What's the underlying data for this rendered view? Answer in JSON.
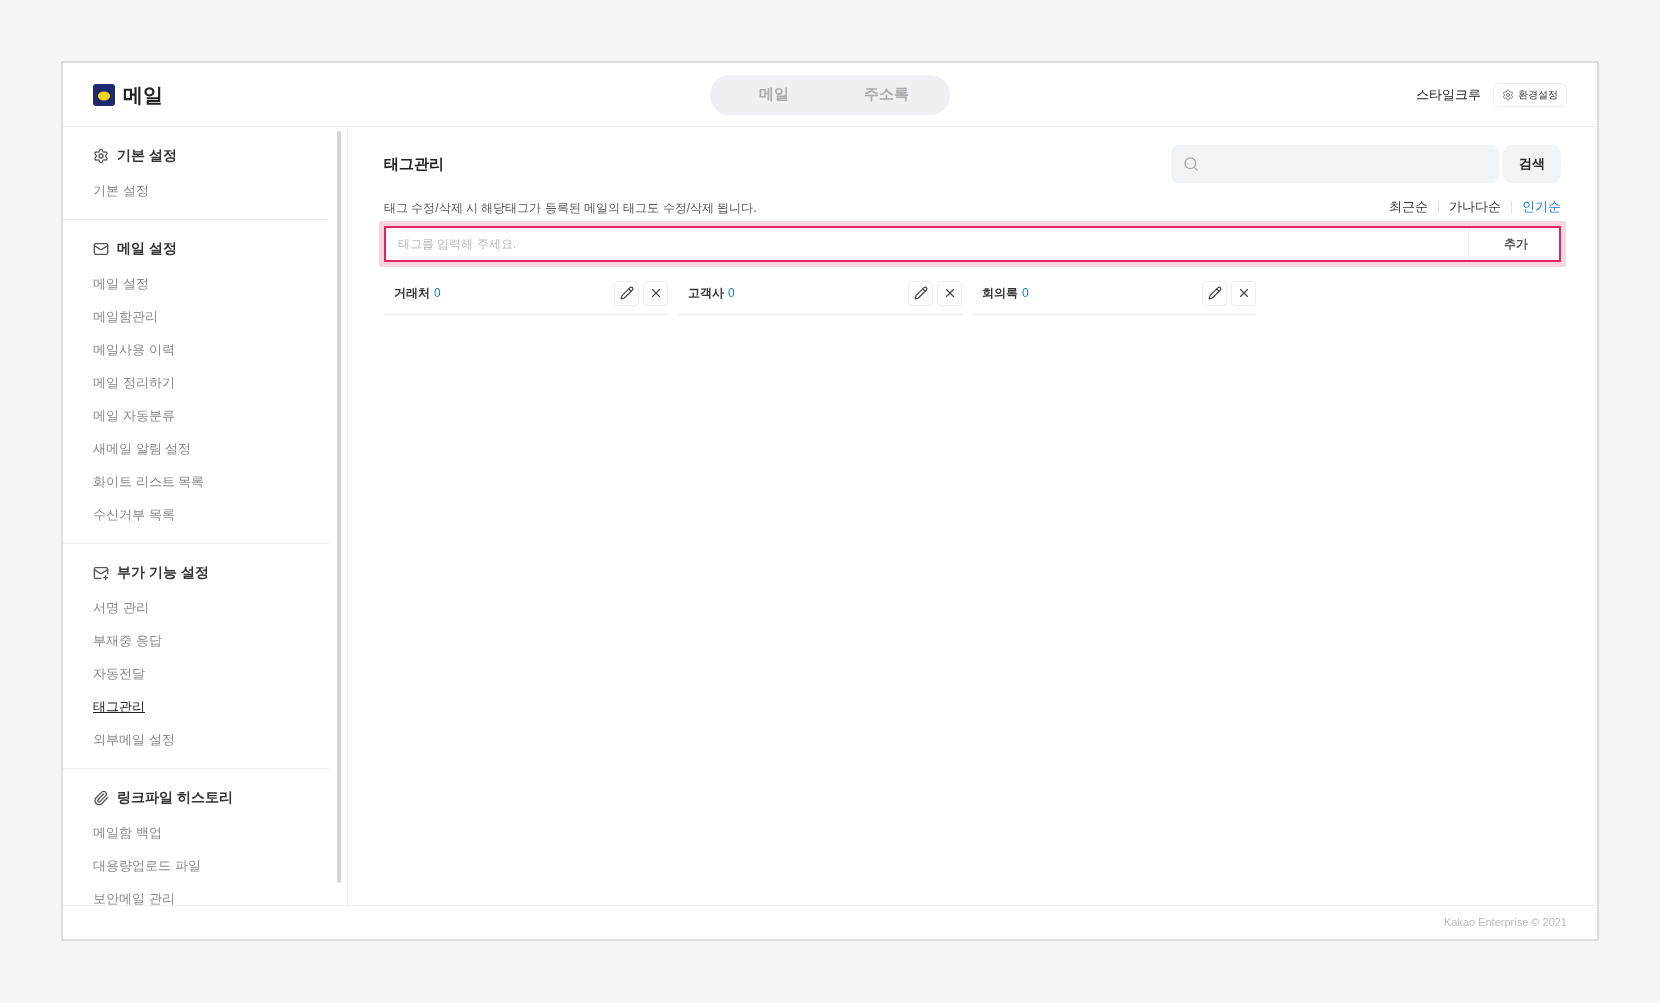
{
  "app": {
    "title": "메일"
  },
  "top_tabs": [
    {
      "label": "메일",
      "selected": false
    },
    {
      "label": "주소록",
      "selected": false
    }
  ],
  "user": {
    "name": "스타일크루",
    "settings_button": "환경설정"
  },
  "sidebar": {
    "sections": [
      {
        "title": "기본 설정",
        "items": [
          {
            "label": "기본 설정",
            "selected": false
          }
        ]
      },
      {
        "title": "메일 설정",
        "items": [
          {
            "label": "메일 설정",
            "selected": false
          },
          {
            "label": "메일함관리",
            "selected": false
          },
          {
            "label": "메일사용 이력",
            "selected": false
          },
          {
            "label": "메일 정리하기",
            "selected": false
          },
          {
            "label": "메일 자동분류",
            "selected": false
          },
          {
            "label": "새메일 알림 설정",
            "selected": false
          },
          {
            "label": "화이트 리스트 목록",
            "selected": false
          },
          {
            "label": "수신거부 목록",
            "selected": false
          }
        ]
      },
      {
        "title": "부가 기능 설정",
        "items": [
          {
            "label": "서명 관리",
            "selected": false
          },
          {
            "label": "부재중 응답",
            "selected": false
          },
          {
            "label": "자동전달",
            "selected": false
          },
          {
            "label": "태그관리",
            "selected": true
          },
          {
            "label": "외부메일 설정",
            "selected": false
          }
        ]
      },
      {
        "title": "링크파일 히스토리",
        "items": [
          {
            "label": "메일함 백업",
            "selected": false
          },
          {
            "label": "대용량업로드 파일",
            "selected": false
          },
          {
            "label": "보안메일 관리",
            "selected": false
          }
        ]
      }
    ]
  },
  "main": {
    "title": "태그관리",
    "search_button": "검색",
    "notice": "태그 수정/삭제 시 해당태그가 등록된 메일의 태그도 수정/삭제 됩니다.",
    "sort_options": [
      {
        "label": "최근순",
        "selected": false
      },
      {
        "label": "가나다순",
        "selected": false
      },
      {
        "label": "인기순",
        "selected": true
      }
    ],
    "tag_input": {
      "placeholder": "태그를 입력해 주세요.",
      "focused": true
    },
    "add_button": "추가",
    "tags": [
      {
        "name": "거래처",
        "count": "0"
      },
      {
        "name": "고객사",
        "count": "0"
      },
      {
        "name": "회의록",
        "count": "0"
      }
    ]
  },
  "footer": {
    "copyright": "Kakao Enterprise © 2021"
  }
}
